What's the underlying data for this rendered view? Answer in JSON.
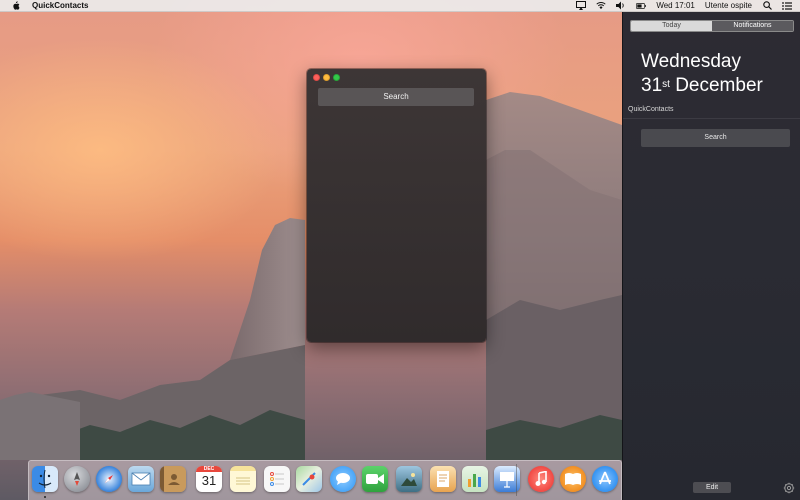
{
  "menubar": {
    "app_name": "QuickContacts",
    "clock": "Wed 17:01",
    "user": "Utente ospite"
  },
  "app_window": {
    "search_label": "Search"
  },
  "notification_center": {
    "tabs": [
      {
        "label": "Today",
        "selected": false
      },
      {
        "label": "Notifications",
        "selected": true
      }
    ],
    "weekday": "Wednesday",
    "day_number": "31",
    "day_suffix": "st",
    "month": "December",
    "widget_title": "QuickContacts",
    "widget_search_label": "Search",
    "edit_label": "Edit"
  },
  "calendar_icon": {
    "month": "DEC",
    "day": "31"
  },
  "dock": {
    "items": [
      {
        "name": "finder-icon",
        "color": "#3e8ee6"
      },
      {
        "name": "launchpad-icon",
        "color": "#8c8f96"
      },
      {
        "name": "safari-icon",
        "color": "#2a7ad8"
      },
      {
        "name": "mail-icon",
        "color": "#6aa7da"
      },
      {
        "name": "contacts-icon",
        "color": "#b88a4c"
      },
      {
        "name": "calendar-icon",
        "color": "#ffffff"
      },
      {
        "name": "notes-icon",
        "color": "#f6e39b"
      },
      {
        "name": "reminders-icon",
        "color": "#f4f4f4"
      },
      {
        "name": "maps-icon",
        "color": "#7fc27a"
      },
      {
        "name": "messages-icon",
        "color": "#3fa0f7"
      },
      {
        "name": "facetime-icon",
        "color": "#38b449"
      },
      {
        "name": "photos-icon",
        "color": "#5f8fa3"
      },
      {
        "name": "pages-icon",
        "color": "#e8a34f"
      },
      {
        "name": "numbers-icon",
        "color": "#49a74b"
      },
      {
        "name": "keynote-icon",
        "color": "#3b7cd6"
      },
      {
        "name": "itunes-icon",
        "color": "#f0443f"
      },
      {
        "name": "ibooks-icon",
        "color": "#f08a1c"
      },
      {
        "name": "app-store-icon",
        "color": "#2c8ef0"
      }
    ]
  }
}
